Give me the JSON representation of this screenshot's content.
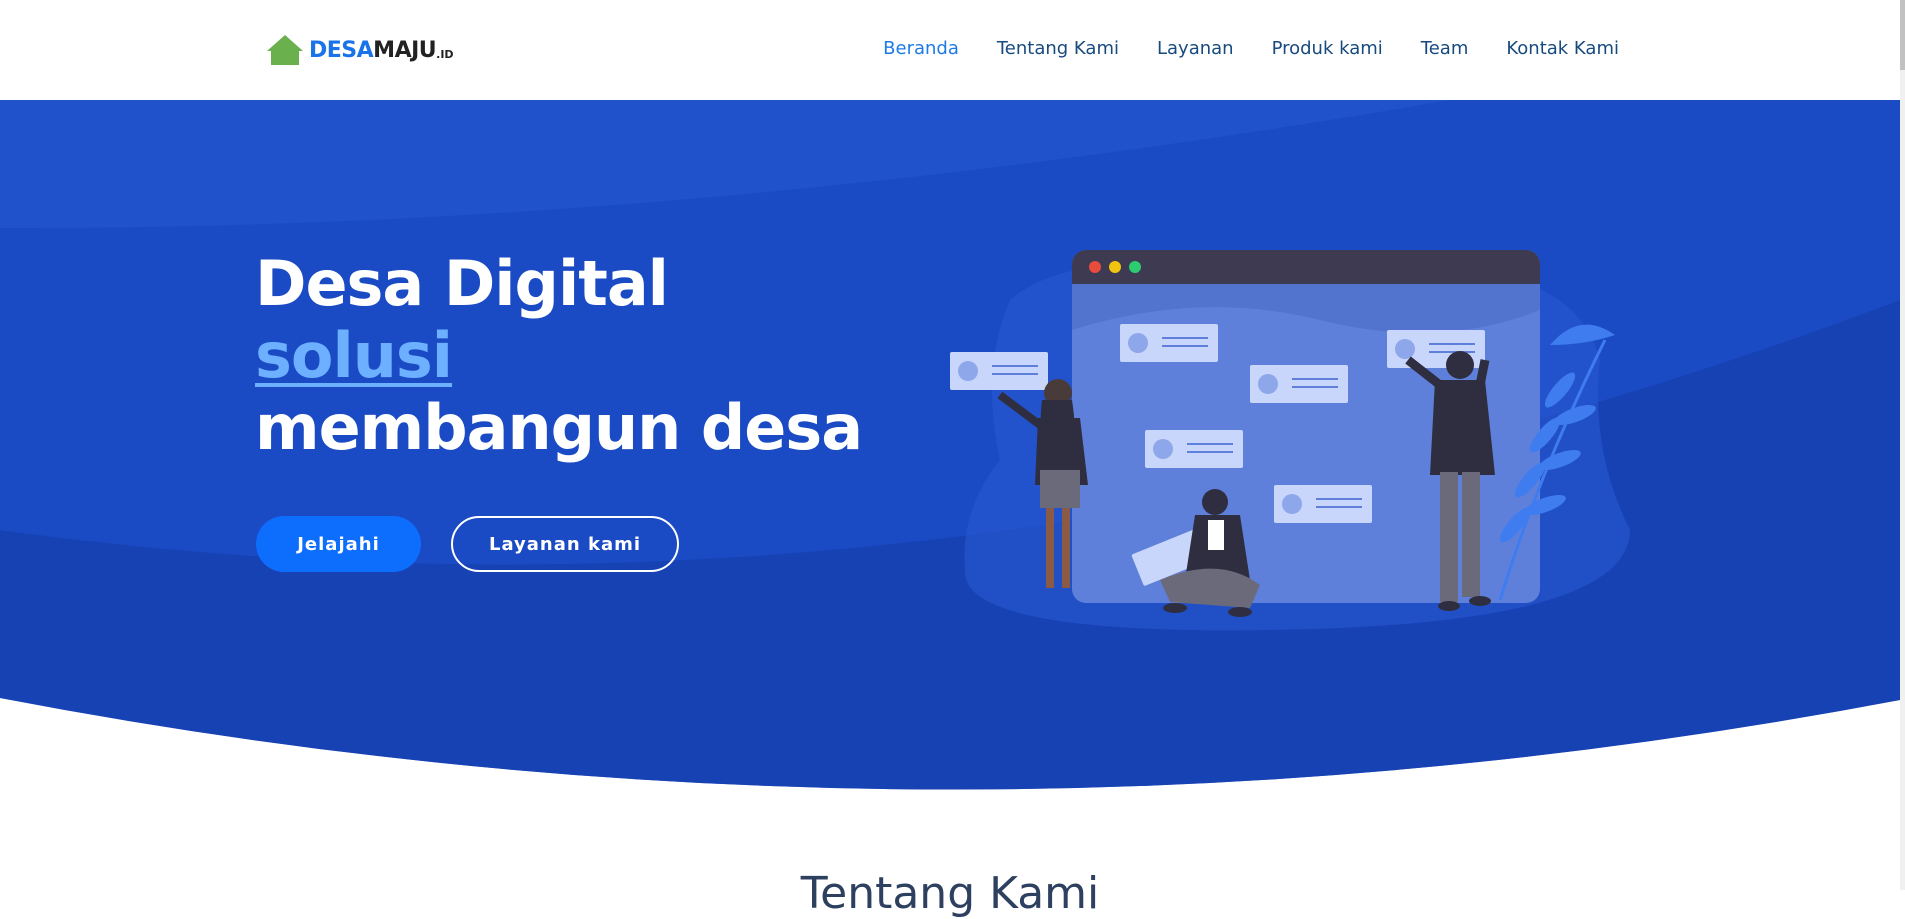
{
  "brand": {
    "part1": "DESA",
    "part2": "MAJU",
    "tld": ".ID",
    "colors": {
      "green": "#6ab04c",
      "blue": "#1a73e8",
      "dark": "#222222"
    }
  },
  "nav": {
    "items": [
      {
        "label": "Beranda",
        "active": true
      },
      {
        "label": "Tentang Kami",
        "active": false
      },
      {
        "label": "Layanan",
        "active": false
      },
      {
        "label": "Produk kami",
        "active": false
      },
      {
        "label": "Team",
        "active": false
      },
      {
        "label": "Kontak Kami",
        "active": false
      }
    ]
  },
  "hero": {
    "line1": "Desa Digital",
    "line2": "solusi",
    "line3": "membangun desa",
    "primary_button": "Jelajahi",
    "secondary_button": "Layanan kami",
    "colors": {
      "background": "#1a4bc4",
      "accent": "#6cb0ff",
      "button": "#0d6efd"
    }
  },
  "illustration": {
    "icon": "team-collaboration-illustration",
    "window_dots": [
      "#e74c3c",
      "#f1c40f",
      "#2ecc71"
    ]
  },
  "next_section": {
    "title": "Tentang Kami"
  }
}
